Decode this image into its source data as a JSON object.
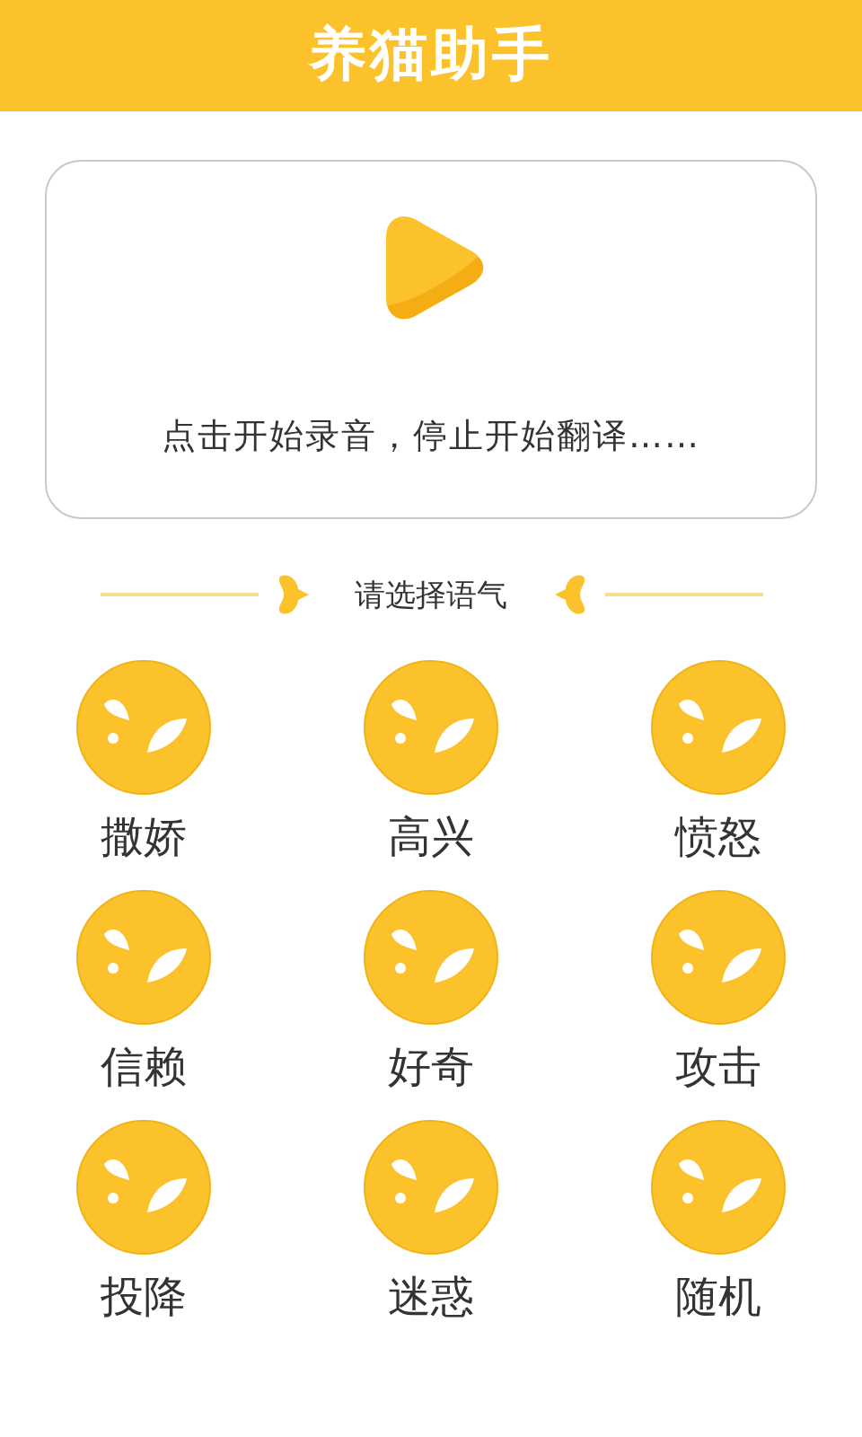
{
  "header": {
    "title": "养猫助手"
  },
  "record_card": {
    "hint": "点击开始录音，停止开始翻译……"
  },
  "section": {
    "title": "请选择语气"
  },
  "moods": [
    {
      "label": "撒娇"
    },
    {
      "label": "高兴"
    },
    {
      "label": "愤怒"
    },
    {
      "label": "信赖"
    },
    {
      "label": "好奇"
    },
    {
      "label": "攻击"
    },
    {
      "label": "投降"
    },
    {
      "label": "迷惑"
    },
    {
      "label": "随机"
    }
  ]
}
